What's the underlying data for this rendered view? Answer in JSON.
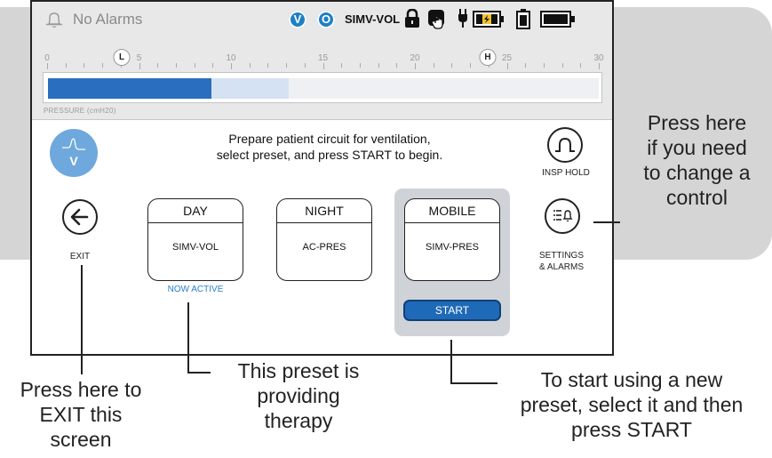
{
  "status_bar": {
    "alarm_text": "No Alarms",
    "badge_v": "V",
    "badge_o": "O",
    "mode": "SIMV-VOL"
  },
  "gauge": {
    "tick_labels": [
      "0",
      "5",
      "10",
      "15",
      "20",
      "25",
      "30"
    ],
    "low_marker": "L",
    "high_marker": "H",
    "label": "PRESSURE (cmH20)",
    "scale_max": 30,
    "current_value": 8.9,
    "range_low": 8.9,
    "range_high": 13.1
  },
  "main": {
    "prompt_line1": "Prepare patient circuit for ventilation,",
    "prompt_line2": "select preset, and press START to begin.",
    "vent_indicator": "V",
    "exit_label": "EXIT",
    "insp_hold_label": "INSP HOLD",
    "settings_label_line1": "SETTINGS",
    "settings_label_line2": "& ALARMS",
    "presets": [
      {
        "name": "DAY",
        "mode": "SIMV-VOL"
      },
      {
        "name": "NIGHT",
        "mode": "AC-PRES"
      },
      {
        "name": "MOBILE",
        "mode": "SIMV-PRES"
      }
    ],
    "now_active": "NOW ACTIVE",
    "start_label": "START"
  },
  "callouts": {
    "control": [
      "Press here",
      "if you need",
      "to change a",
      "control"
    ],
    "exit": [
      "Press here to",
      "EXIT this",
      "screen"
    ],
    "preset": [
      "This preset is",
      "providing",
      "therapy"
    ],
    "start": [
      "To start using a new",
      "preset, select it and then",
      "press START"
    ]
  },
  "colors": {
    "accent_blue": "#2a6fbf",
    "badge_blue": "#1f7fc4",
    "indicator_blue": "#6fa8dc",
    "panel_gray": "#d5d5d5"
  }
}
